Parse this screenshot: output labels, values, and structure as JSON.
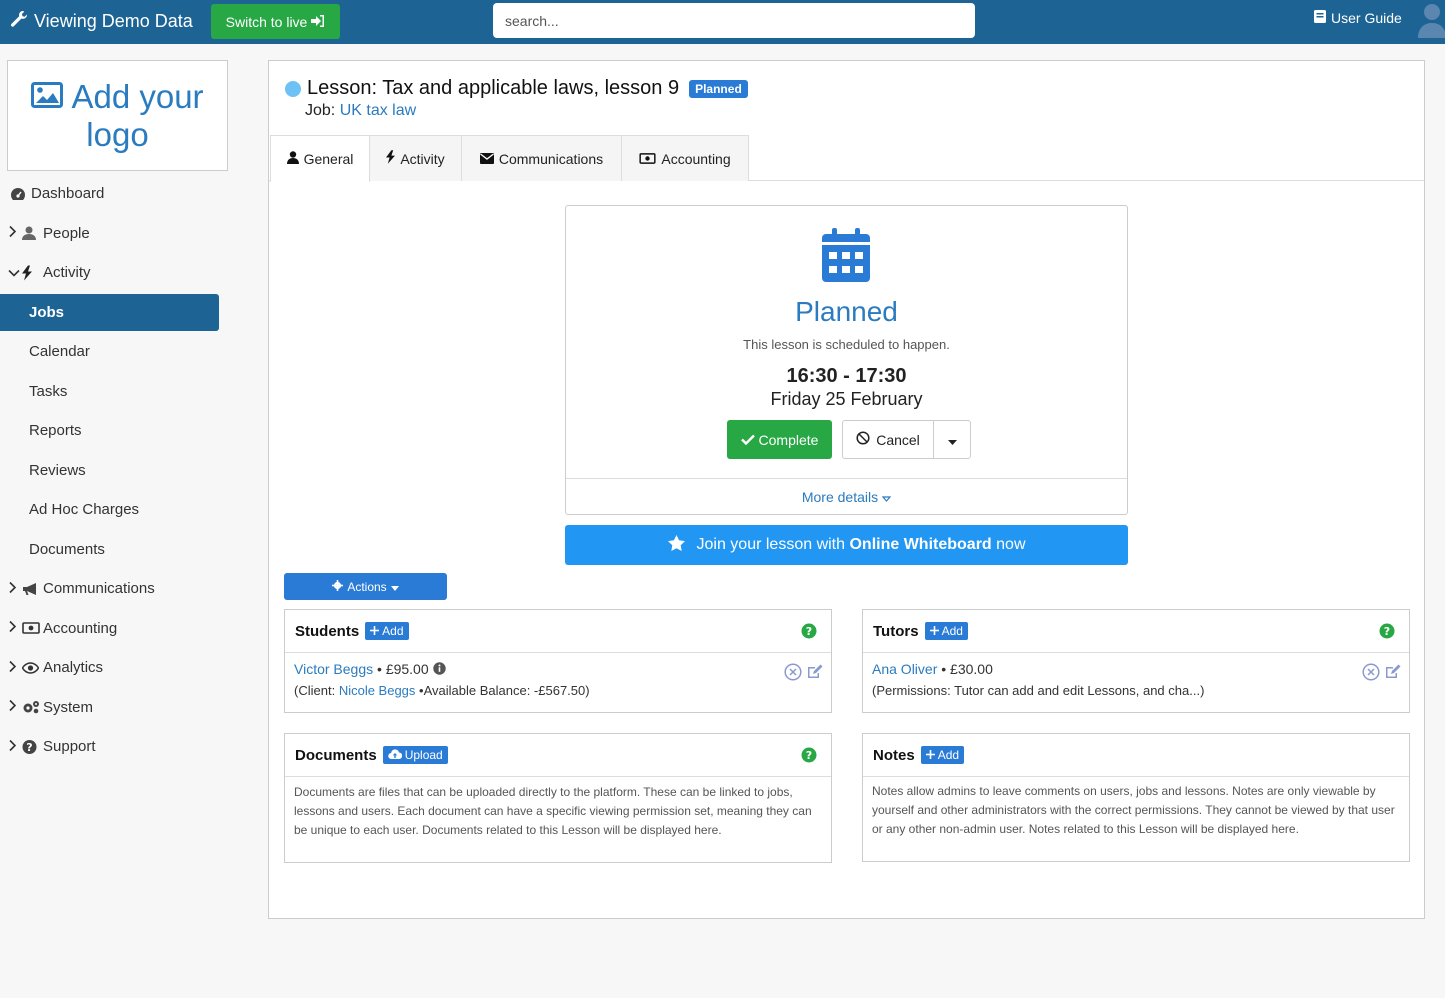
{
  "topbar": {
    "brand": "Viewing Demo Data",
    "switch_live": "Switch to live",
    "search_placeholder": "search...",
    "user_guide": "User Guide"
  },
  "logo": {
    "line1": "Add your",
    "line2": "logo"
  },
  "nav": {
    "dashboard": "Dashboard",
    "people": "People",
    "activity": "Activity",
    "jobs": "Jobs",
    "calendar": "Calendar",
    "tasks": "Tasks",
    "reports": "Reports",
    "reviews": "Reviews",
    "adhoc": "Ad Hoc Charges",
    "documents": "Documents",
    "communications": "Communications",
    "accounting": "Accounting",
    "analytics": "Analytics",
    "system": "System",
    "support": "Support"
  },
  "lesson": {
    "title": "Lesson: Tax and applicable laws, lesson 9",
    "badge": "Planned",
    "job_prefix": "Job:",
    "job_name": "UK tax law"
  },
  "tabs": {
    "general": "General",
    "activity": "Activity",
    "communications": "Communications",
    "accounting": "Accounting"
  },
  "status": {
    "word": "Planned",
    "description": "This lesson is scheduled to happen.",
    "time": "16:30 - 17:30",
    "date": "Friday 25 February",
    "complete": "Complete",
    "cancel": "Cancel",
    "more_details": "More details"
  },
  "whiteboard": {
    "pre": "Join your lesson with",
    "bold": "Online Whiteboard",
    "post": "now"
  },
  "actions": "Actions",
  "students": {
    "title": "Students",
    "add": "Add",
    "name": "Victor Beggs",
    "sep": "•",
    "amount": "£95.00",
    "client_prefix": "(Client:",
    "client_name": "Nicole Beggs",
    "balance": "•Available Balance: -£567.50)"
  },
  "tutors": {
    "title": "Tutors",
    "add": "Add",
    "name": "Ana Oliver",
    "sep": "•",
    "amount": "£30.00",
    "permissions": "(Permissions: Tutor can add and edit Lessons, and cha...)"
  },
  "documents": {
    "title": "Documents",
    "upload": "Upload",
    "text": "Documents are files that can be uploaded directly to the platform. These can be linked to jobs, lessons and users. Each document can have a specific viewing permission set, meaning they can be unique to each user. Documents related to this Lesson will be displayed here."
  },
  "notes": {
    "title": "Notes",
    "add": "Add",
    "text": "Notes allow admins to leave comments on users, jobs and lessons. Notes are only viewable by yourself and other administrators with the correct permissions. They cannot be viewed by that user or any other non-admin user. Notes related to this Lesson will be displayed here."
  },
  "colors": {
    "topbar": "#1d6494",
    "accent": "#2a7bbf",
    "success": "#28a745",
    "whiteboard": "#2196f3"
  }
}
